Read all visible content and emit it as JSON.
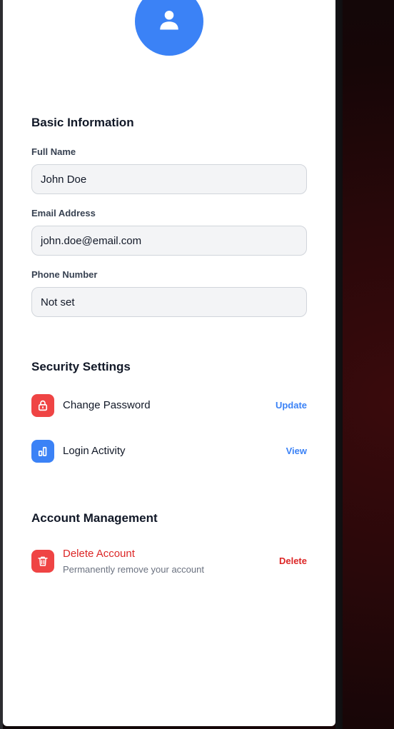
{
  "profile": {
    "avatar_icon": "user-icon",
    "accent": "#3b82f6"
  },
  "basic_info": {
    "title": "Basic Information",
    "full_name": {
      "label": "Full Name",
      "value": "John Doe"
    },
    "email": {
      "label": "Email Address",
      "value": "john.doe@email.com"
    },
    "phone": {
      "label": "Phone Number",
      "value": "Not set"
    }
  },
  "security": {
    "title": "Security Settings",
    "items": [
      {
        "label": "Change Password",
        "icon": "lock-icon",
        "action": "Update",
        "icon_color": "#ef4444",
        "action_color": "#3b82f6"
      },
      {
        "label": "Login Activity",
        "icon": "activity-chart-icon",
        "action": "View",
        "icon_color": "#3b82f6",
        "action_color": "#3b82f6"
      }
    ]
  },
  "account": {
    "title": "Account Management",
    "delete": {
      "label": "Delete Account",
      "description": "Permanently remove your account",
      "icon": "trash-icon",
      "action": "Delete",
      "color": "#ef4444"
    }
  }
}
